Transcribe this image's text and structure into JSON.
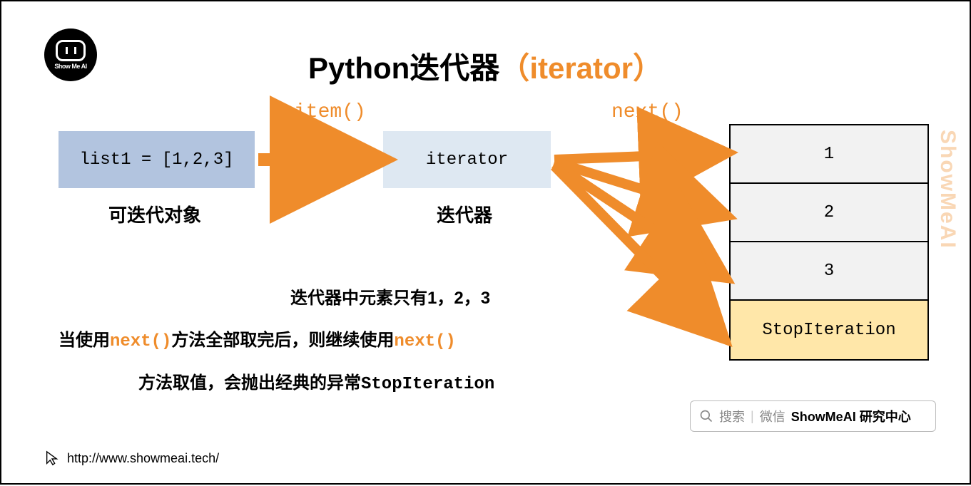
{
  "logo_text": "Show Me AI",
  "title_main": "Python迭代器",
  "title_paren_open": "（",
  "title_term": "iterator",
  "title_paren_close": "）",
  "iterable_box": "list1 = [1,2,3]",
  "iterable_label": "可迭代对象",
  "iterator_box": "iterator",
  "iterator_label": "迭代器",
  "fn_item": "item()",
  "fn_next": "next()",
  "stack": [
    "1",
    "2",
    "3",
    "StopIteration"
  ],
  "desc1": "迭代器中元素只有1，2，3",
  "desc2_a": "当使用",
  "desc2_b": "next()",
  "desc2_c": "方法全部取完后，则继续使用",
  "desc2_d": "next()",
  "desc3_a": "方法取值，会抛出经典的异常",
  "desc3_b": "StopIteration",
  "url": "http://www.showmeai.tech/",
  "search_label": "搜索",
  "search_sub": "微信",
  "search_strong": "ShowMeAI 研究中心",
  "watermark": "ShowMeAI"
}
